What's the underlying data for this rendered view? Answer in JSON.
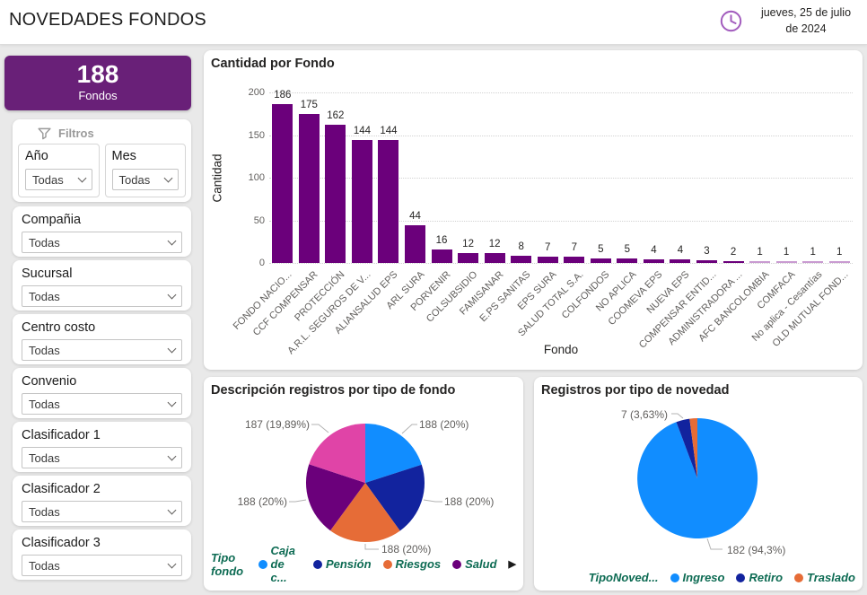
{
  "header": {
    "title": "NOVEDADES FONDOS",
    "date": "jueves, 25 de julio de 2024"
  },
  "sidebar": {
    "kpi": {
      "value": "188",
      "label": "Fondos"
    },
    "filters_title": "Filtros",
    "filter_pairs": [
      {
        "label": "Año",
        "value": "Todas"
      },
      {
        "label": "Mes",
        "value": "Todas"
      }
    ],
    "filter_cards": [
      {
        "label": "Compañia",
        "value": "Todas"
      },
      {
        "label": "Sucursal",
        "value": "Todas"
      },
      {
        "label": "Centro costo",
        "value": "Todas"
      },
      {
        "label": "Convenio",
        "value": "Todas"
      },
      {
        "label": "Clasificador 1",
        "value": "Todas"
      },
      {
        "label": "Clasificador 2",
        "value": "Todas"
      },
      {
        "label": "Clasificador 3",
        "value": "Todas"
      }
    ]
  },
  "colors": {
    "kpi_bg": "#692078",
    "bar_purple": "#6B007B",
    "bar_purple_faint": "#C99BD1",
    "blue": "#118DFF",
    "navy": "#12239E",
    "orange": "#E66C37",
    "magenta": "#E044A7",
    "legend_text": "#0D6B53",
    "clock_icon": "#A35EBE"
  },
  "chart_data": [
    {
      "type": "bar",
      "title": "Cantidad por Fondo",
      "xlabel": "Fondo",
      "ylabel": "Cantidad",
      "ylim": [
        0,
        200
      ],
      "yticks": [
        0,
        50,
        100,
        150,
        200
      ],
      "grid": "dotted-horizontal",
      "bar_color": "#6B007B",
      "categories": [
        "FONDO NACIO...",
        "CCF COMPENSAR",
        "PROTECCIÓN",
        "A.R.L. SEGUROS DE V...",
        "ALIANSALUD EPS",
        "ARL SURA",
        "PORVENIR",
        "COLSUBSIDIO",
        "FAMISANAR",
        "E.PS SANITAS",
        "EPS SURA",
        "SALUD TOTAL S.A.",
        "COLFONDOS",
        "NO APLICA",
        "COOMEVA EPS",
        "NUEVA EPS",
        "COMPENSAR ENTID...",
        "ADMINISTRADORA ...",
        "AFC BANCOLOMBIA",
        "COMFACA",
        "No aplica - Cesantías",
        "OLD MUTUAL FOND..."
      ],
      "values": [
        186,
        175,
        162,
        144,
        144,
        44,
        16,
        12,
        12,
        8,
        7,
        7,
        5,
        5,
        4,
        4,
        3,
        2,
        1,
        1,
        1,
        1
      ]
    },
    {
      "type": "pie",
      "title": "Descripción registros por tipo de fondo",
      "legend_title": "Tipo fondo",
      "legend_position": "bottom",
      "legend_has_more": true,
      "slices": [
        {
          "label": "Caja de c...",
          "value": 188,
          "pct_label": "188 (20%)",
          "color": "#118DFF"
        },
        {
          "label": "Pensión",
          "value": 188,
          "pct_label": "188 (20%)",
          "color": "#12239E"
        },
        {
          "label": "Riesgos",
          "value": 188,
          "pct_label": "188 (20%)",
          "color": "#E66C37"
        },
        {
          "label": "Salud",
          "value": 188,
          "pct_label": "188 (20%)",
          "color": "#6B007B"
        },
        {
          "label": "",
          "value": 187,
          "pct_label": "187 (19,89%)",
          "color": "#E044A7"
        }
      ]
    },
    {
      "type": "pie",
      "title": "Registros por tipo de novedad",
      "legend_title": "TipoNoved...",
      "legend_position": "bottom",
      "legend_has_more": false,
      "slices": [
        {
          "label": "Ingreso",
          "value": 182,
          "pct_label": "182 (94,3%)",
          "color": "#118DFF"
        },
        {
          "label": "Retiro",
          "value": 7,
          "pct_label": "7 (3,63%)",
          "color": "#12239E"
        },
        {
          "label": "Traslado",
          "value": 4,
          "pct_label": "",
          "color": "#E66C37"
        }
      ]
    }
  ]
}
